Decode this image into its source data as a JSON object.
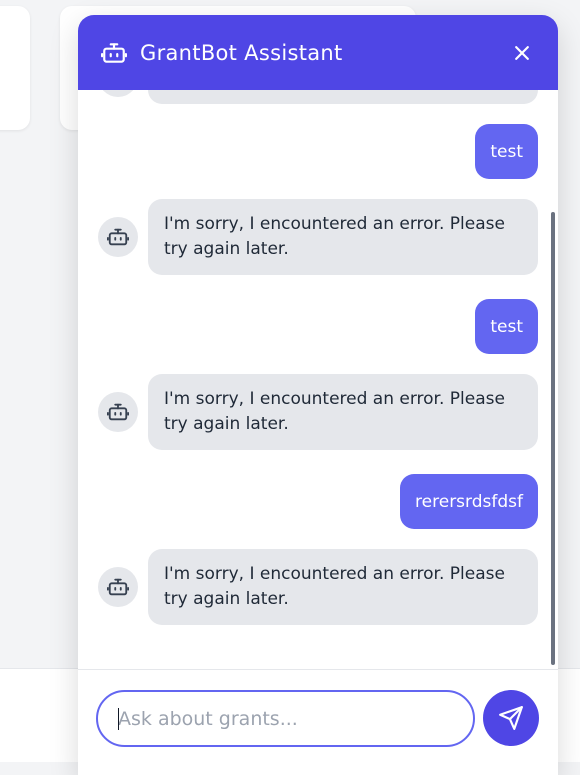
{
  "colors": {
    "header_bg": "#4f46e5",
    "user_bubble": "#6366f1",
    "bot_bubble": "#e5e7eb",
    "send_button": "#4f46e5"
  },
  "header": {
    "title": "GrantBot Assistant",
    "icon": "robot-icon",
    "close_icon": "close-icon"
  },
  "messages": [
    {
      "role": "bot",
      "text": ""
    },
    {
      "role": "user",
      "text": "test"
    },
    {
      "role": "bot",
      "text": "I'm sorry, I encountered an error. Please try again later."
    },
    {
      "role": "user",
      "text": "test"
    },
    {
      "role": "bot",
      "text": "I'm sorry, I encountered an error. Please try again later."
    },
    {
      "role": "user",
      "text": "rerersrdsfdsf"
    },
    {
      "role": "bot",
      "text": "I'm sorry, I encountered an error. Please try again later."
    }
  ],
  "input": {
    "placeholder": "Ask about grants...",
    "value": "",
    "send_icon": "send-icon"
  }
}
